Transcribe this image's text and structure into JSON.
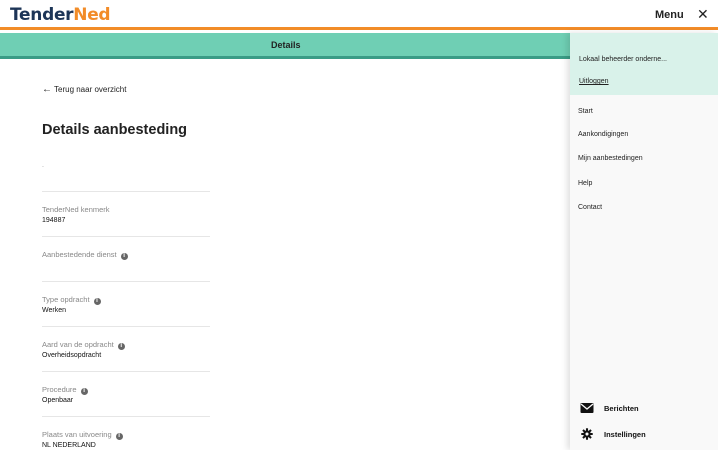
{
  "header": {
    "logo_part1": "Tender",
    "logo_part2": "Ned",
    "menu_label": "Menu",
    "close_glyph": "✕"
  },
  "tab_band": {
    "label": "Details"
  },
  "main": {
    "back_link": "Terug naar overzicht",
    "page_title": "Details aanbesteding",
    "dot": ".",
    "fields": [
      {
        "label": "TenderNed kenmerk",
        "value": "194887",
        "info": false
      },
      {
        "label": "Aanbestedende dienst",
        "value": "",
        "info": true
      },
      {
        "label": "Type opdracht",
        "value": "Werken",
        "info": true
      },
      {
        "label": "Aard van de opdracht",
        "value": "Overheidsopdracht",
        "info": true
      },
      {
        "label": "Procedure",
        "value": "Openbaar",
        "info": true
      },
      {
        "label": "Plaats van uitvoering",
        "value": "NL NEDERLAND",
        "info": true
      }
    ]
  },
  "side_menu": {
    "user_name": "Lokaal beheerder onderne...",
    "logout": "Uitloggen",
    "items": [
      "Start",
      "Aankondigingen",
      "Mijn aanbestedingen",
      "Help",
      "Contact"
    ],
    "bottom": [
      {
        "label": "Berichten",
        "icon": "envelope-icon"
      },
      {
        "label": "Instellingen",
        "icon": "gear-icon"
      }
    ]
  },
  "colors": {
    "accent_orange": "#f28c28",
    "band_green": "#6fcfb4",
    "panel_user_bg": "#d9f2ea",
    "logo_navy": "#1d3557"
  }
}
